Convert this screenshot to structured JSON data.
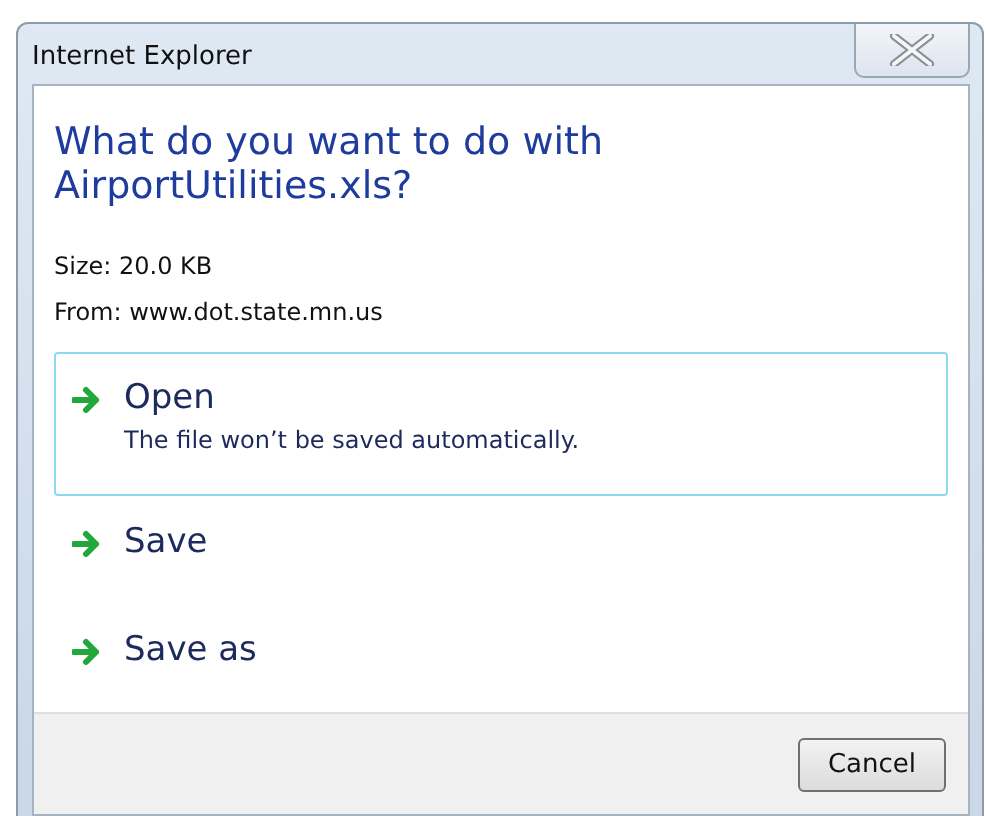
{
  "window": {
    "title": "Internet Explorer"
  },
  "heading": "What do you want to do with AirportUtilities.xls?",
  "details": [
    "Size: 20.0 KB",
    "From: www.dot.state.mn.us"
  ],
  "options": [
    {
      "label": "Open",
      "description": "The file won’t be saved automatically.",
      "selected": true
    },
    {
      "label": "Save",
      "selected": false
    },
    {
      "label": "Save as",
      "selected": false
    }
  ],
  "buttons": [
    "Cancel"
  ]
}
